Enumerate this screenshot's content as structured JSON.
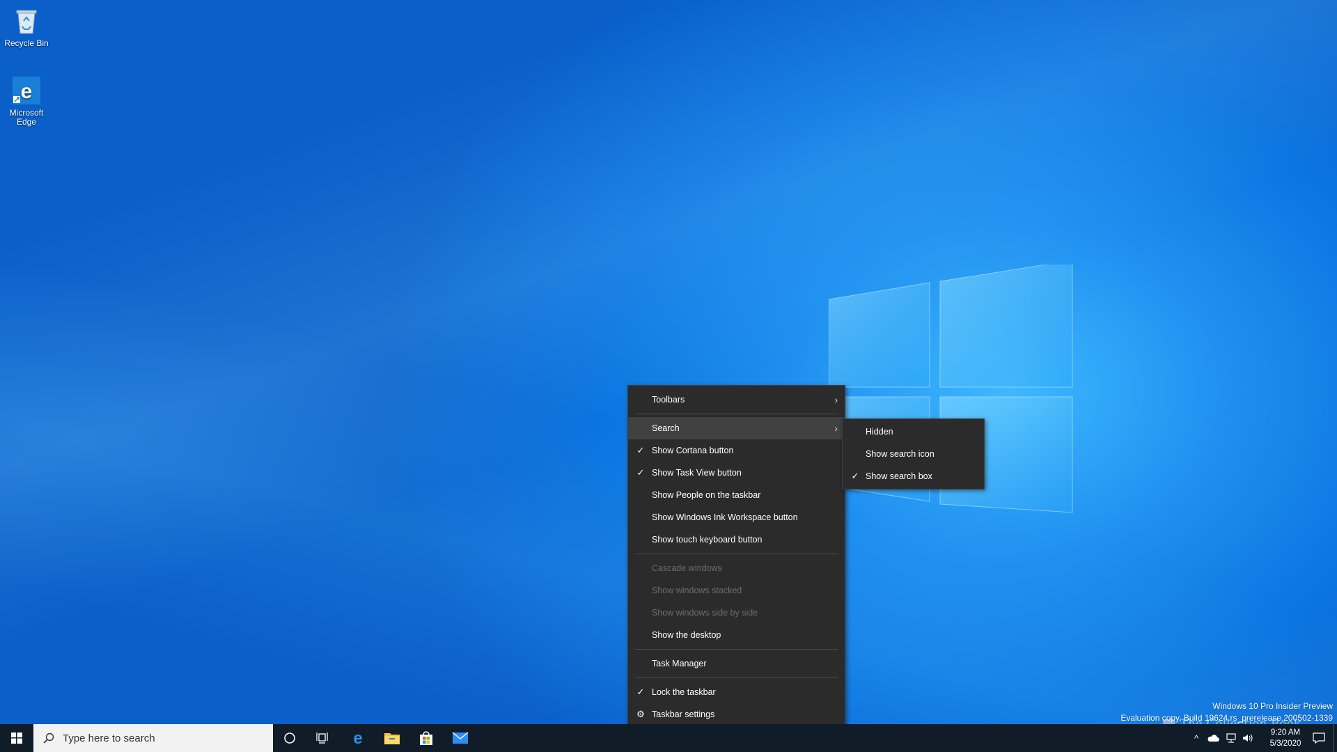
{
  "desktop": {
    "icons": [
      {
        "label": "Recycle Bin",
        "icon": "recycle-bin-icon"
      },
      {
        "label": "Microsoft Edge",
        "icon": "edge-icon"
      }
    ]
  },
  "context_menu": {
    "items": [
      {
        "label": "Toolbars",
        "submenu": true
      },
      {
        "label": "Search",
        "submenu": true,
        "highlighted": true
      },
      {
        "label": "Show Cortana button",
        "checked": true
      },
      {
        "label": "Show Task View button",
        "checked": true
      },
      {
        "label": "Show People on the taskbar"
      },
      {
        "label": "Show Windows Ink Workspace button"
      },
      {
        "label": "Show touch keyboard button"
      },
      {
        "label": "Cascade windows",
        "disabled": true
      },
      {
        "label": "Show windows stacked",
        "disabled": true
      },
      {
        "label": "Show windows side by side",
        "disabled": true
      },
      {
        "label": "Show the desktop"
      },
      {
        "label": "Task Manager"
      },
      {
        "label": "Lock the taskbar",
        "checked": true
      },
      {
        "label": "Taskbar settings",
        "icon": "gear-icon"
      }
    ]
  },
  "search_submenu": {
    "items": [
      {
        "label": "Hidden"
      },
      {
        "label": "Show search icon"
      },
      {
        "label": "Show search box",
        "checked": true
      }
    ]
  },
  "taskbar": {
    "search_placeholder": "Type here to search",
    "clock_time": "9:20 AM",
    "clock_date": "5/3/2020",
    "pinned": [
      "cortana-icon",
      "task-view-icon",
      "edge-icon",
      "file-explorer-icon",
      "store-icon",
      "mail-icon"
    ]
  },
  "watermark": {
    "line1": "Windows 10 Pro Insider Preview",
    "line2": "Evaluation copy. Build 19624.rs_prerelease.200502-1339",
    "site": "The Collection Book"
  },
  "colors": {
    "menu_bg": "#2b2b2b",
    "menu_highlight": "#414141",
    "taskbar_bg": "#101c28",
    "desktop_accent": "#0b74e0"
  }
}
